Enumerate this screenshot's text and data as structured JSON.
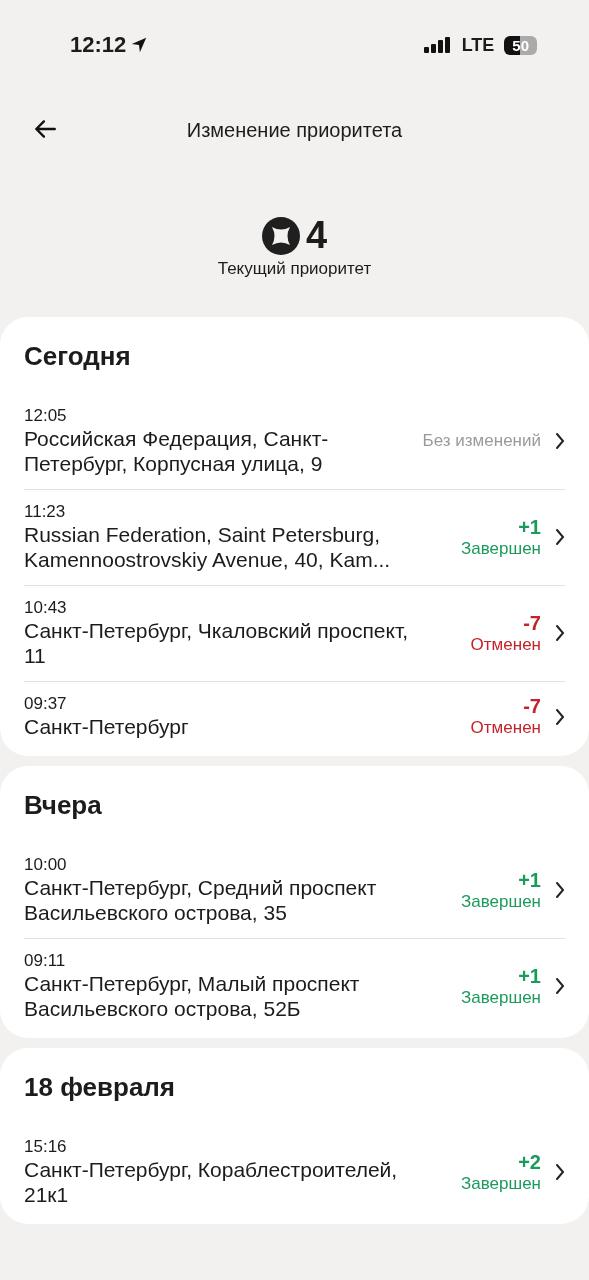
{
  "status_bar": {
    "time": "12:12",
    "network": "LTE",
    "battery": "50"
  },
  "header": {
    "title": "Изменение приоритета"
  },
  "priority": {
    "value": "4",
    "label": "Текущий приоритет"
  },
  "sections": [
    {
      "title": "Сегодня",
      "items": [
        {
          "time": "12:05",
          "address": "Российская Федерация, Санкт-Петербург, Корпусная улица, 9",
          "kind": "unchanged",
          "status": "Без изменений"
        },
        {
          "time": "11:23",
          "address": "Russian Federation, Saint Petersburg, Kamennoostrovskiy Avenue, 40, Kam...",
          "kind": "completed",
          "delta": "+1",
          "status": "Завершен"
        },
        {
          "time": "10:43",
          "address": "Санкт-Петербург, Чкаловский проспект, 11",
          "kind": "cancelled",
          "delta": "-7",
          "status": "Отменен"
        },
        {
          "time": "09:37",
          "address": "Санкт-Петербург",
          "kind": "cancelled",
          "delta": "-7",
          "status": "Отменен"
        }
      ]
    },
    {
      "title": "Вчера",
      "items": [
        {
          "time": "10:00",
          "address": "Санкт-Петербург, Средний проспект Васильевского острова, 35",
          "kind": "completed",
          "delta": "+1",
          "status": "Завершен"
        },
        {
          "time": "09:11",
          "address": "Санкт-Петербург, Малый проспект Васильевского острова, 52Б",
          "kind": "completed",
          "delta": "+1",
          "status": "Завершен"
        }
      ]
    },
    {
      "title": "18 февраля",
      "items": [
        {
          "time": "15:16",
          "address": "Санкт-Петербург, Кораблестроителей, 21к1",
          "kind": "completed",
          "delta": "+2",
          "status": "Завершен"
        }
      ]
    }
  ]
}
